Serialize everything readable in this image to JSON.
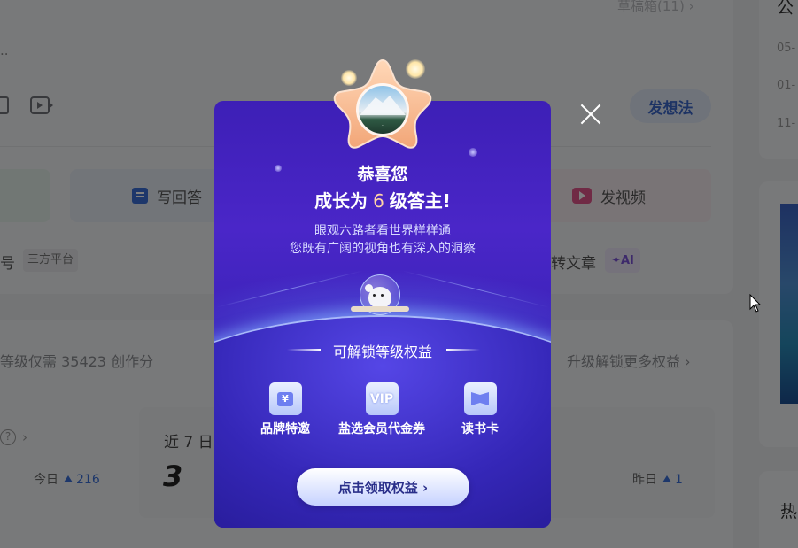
{
  "background": {
    "drafts_label": "草稿箱(11)",
    "ellipsis": "..",
    "idea_button": "发想法",
    "quick_actions": {
      "answer_label": "写回答",
      "video_label": "发视频"
    },
    "hao_label": "号",
    "third_party_tag": "三方平台",
    "article_label": "转文章",
    "ai_tag": "AI",
    "level_need_text": "等级仅需 35423 创作分",
    "unlock_more": "升级解锁更多权益",
    "near7_label": "近 7 日",
    "near7_value": "3",
    "today_label": "今日",
    "today_value": "216",
    "yesterday_label": "昨日",
    "yesterday_value": "1",
    "right_title": "公",
    "right_dates": [
      "05-",
      "01-",
      "11-"
    ],
    "right_bottom_title": "热"
  },
  "modal": {
    "title_line1": "恭喜您",
    "title_prefix": "成长为",
    "level": "6",
    "title_suffix": "级答主!",
    "subtitle_line1": "眼观六路者看世界样样通",
    "subtitle_line2": "您既有广阔的视角也有深入的洞察",
    "section_title": "可解锁等级权益",
    "perks": [
      {
        "label": "品牌特邀",
        "icon": "brand-invite-icon",
        "glyph": "¥"
      },
      {
        "label": "盐选会员代金券",
        "icon": "vip-coupon-icon",
        "glyph": "VIP"
      },
      {
        "label": "读书卡",
        "icon": "book-card-icon"
      }
    ],
    "claim_button": "点击领取权益 ›"
  }
}
